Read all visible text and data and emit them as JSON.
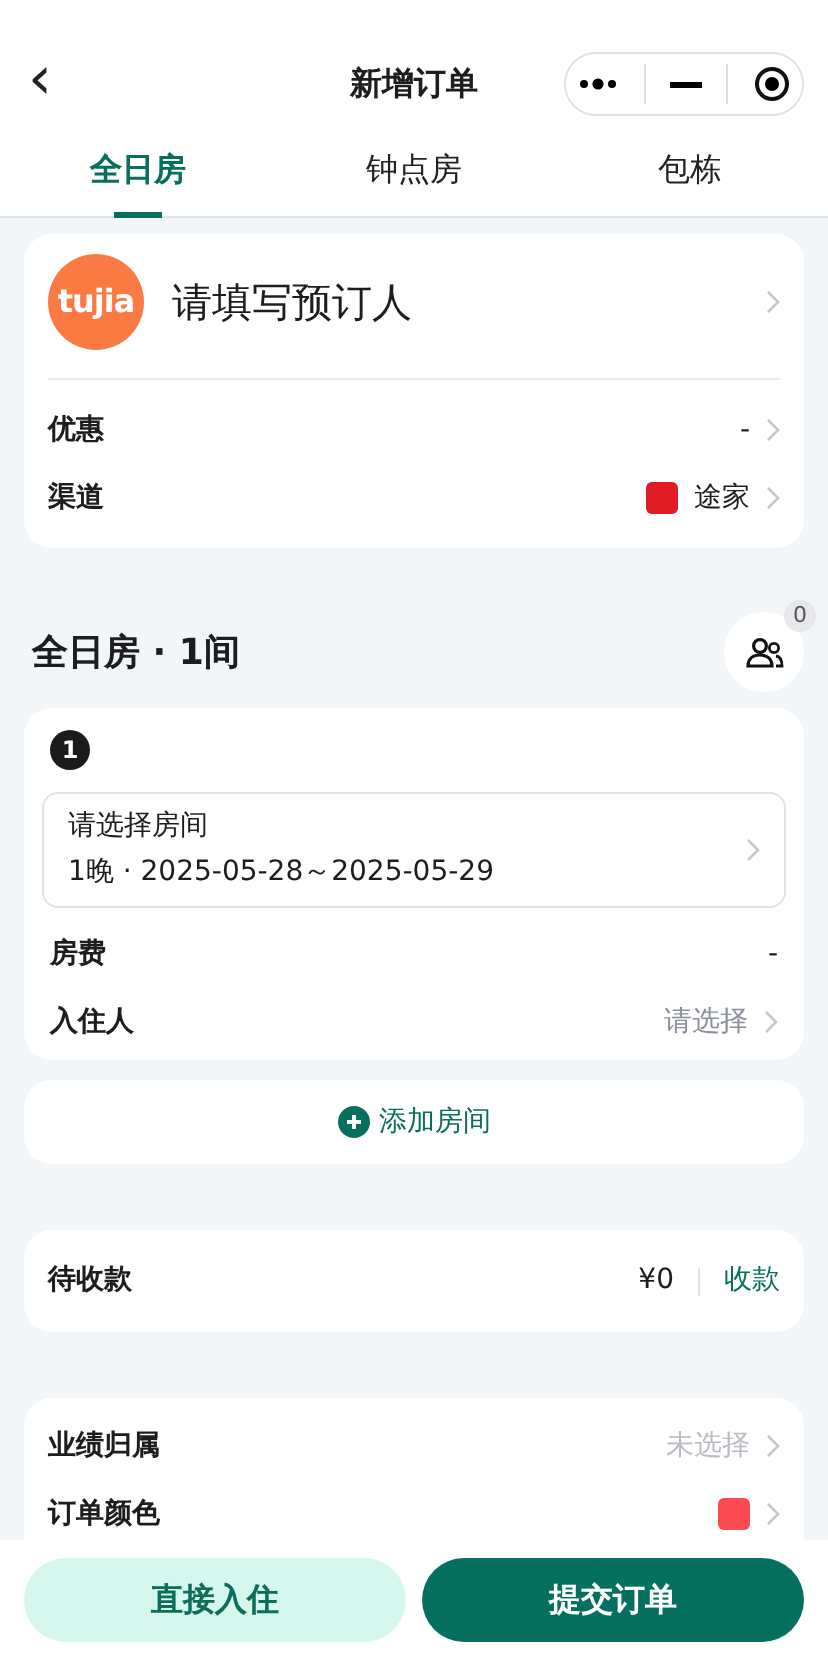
{
  "header": {
    "back": "‹",
    "title": "新增订单"
  },
  "tabs": [
    {
      "label": "全日房",
      "selected": true
    },
    {
      "label": "钟点房",
      "selected": false
    },
    {
      "label": "包栋",
      "selected": false
    }
  ],
  "booker": {
    "logo_text": "tujia",
    "placeholder": "请填写预订人"
  },
  "order_rows": [
    {
      "kind": "text",
      "label": "优惠",
      "value": "-"
    },
    {
      "kind": "color",
      "label": "渠道",
      "value": "途家",
      "color": "#e01b24"
    }
  ],
  "section": {
    "title": "全日房 · 1间",
    "guest_count": "0"
  },
  "rooms": [
    {
      "number": "1",
      "room_placeholder": "请选择房间",
      "dates": "1晚 · 2025-05-28～2025-05-29",
      "fee_label": "房费",
      "fee": "-",
      "guest_label": "入住人",
      "guest_value": "请选择"
    }
  ],
  "add_room": "添加房间",
  "payment": {
    "label": "待收款",
    "amount": "¥0",
    "action": "收款"
  },
  "extra_rows": [
    {
      "kind": "text",
      "label": "业绩归属",
      "value": "未选择"
    },
    {
      "kind": "color",
      "label": "订单颜色",
      "color": "#fb4a52"
    }
  ],
  "buttons": [
    {
      "label": "直接入住",
      "kind": "secondary"
    },
    {
      "label": "提交订单",
      "kind": "primary"
    }
  ]
}
